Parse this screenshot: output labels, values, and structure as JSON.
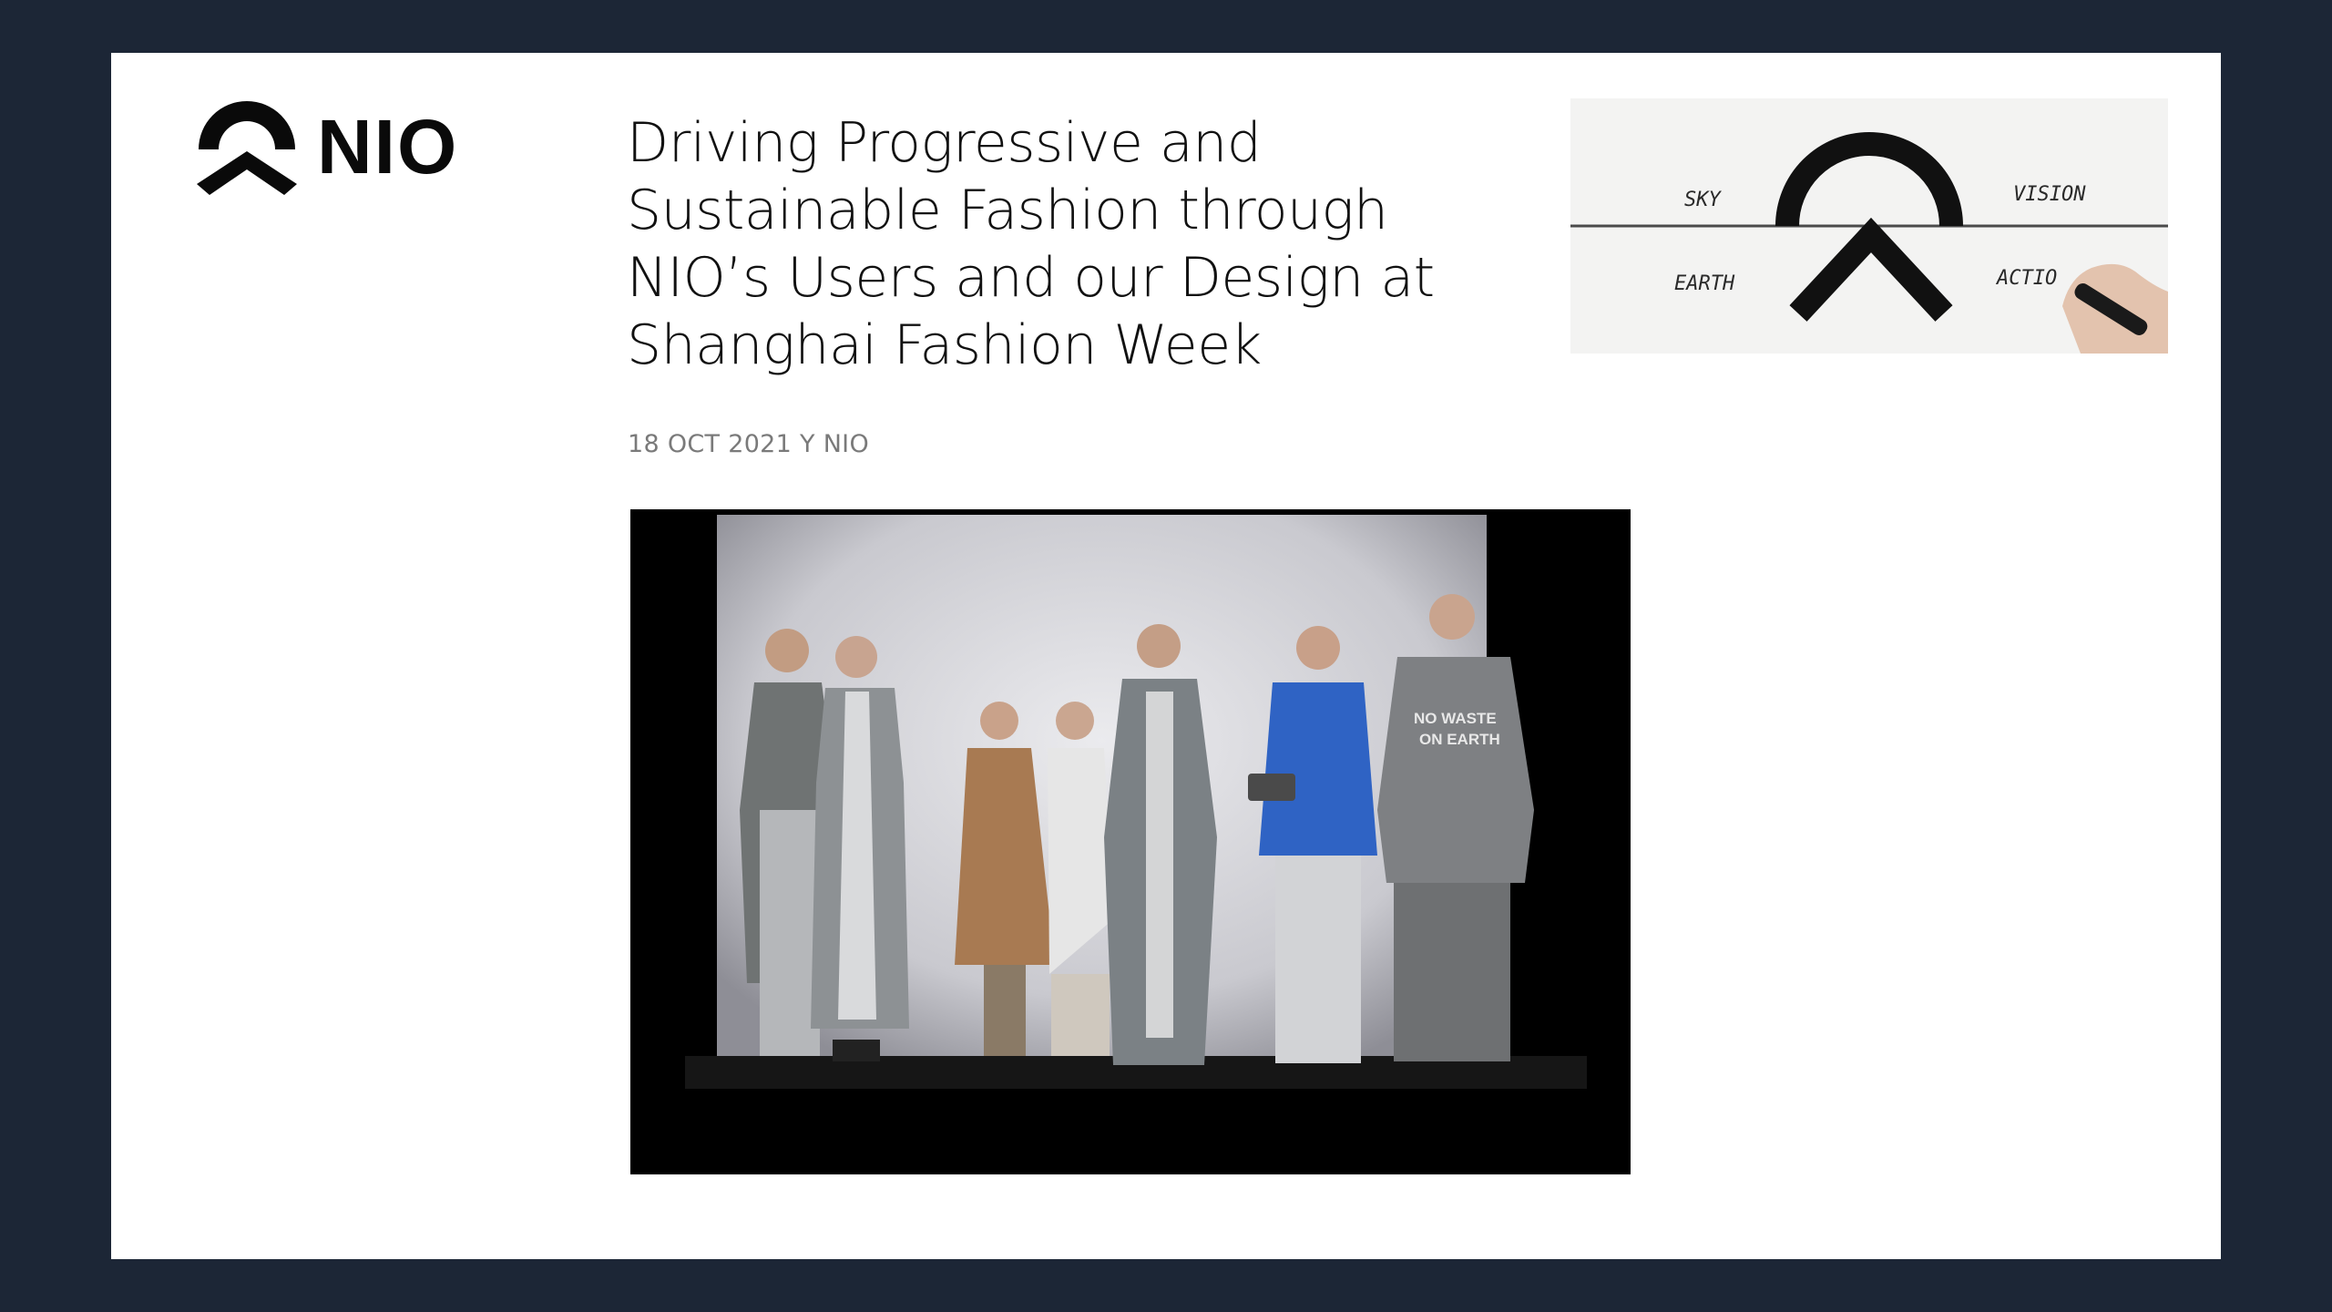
{
  "brand": {
    "name": "NIO"
  },
  "article": {
    "headline_lines": [
      "Driving Progressive and",
      "Sustainable Fashion through",
      "NIO’s Users and our Design at",
      "Shanghai Fashion Week"
    ],
    "dateline": "18 OCT 2021 Y NIO"
  },
  "sketch_image": {
    "labels": {
      "sky": "SKY",
      "vision": "VISION",
      "earth": "EARTH",
      "action": "ACTIO"
    }
  },
  "runway_photo": {
    "shirt_text_line1": "NO WASTE",
    "shirt_text_line2": "ON EARTH"
  },
  "colors": {
    "frame_background": "#1c2636",
    "slide_background": "#ffffff",
    "logo": "#0a0a0a",
    "headline": "#111111",
    "dateline": "#7a7a7a"
  }
}
